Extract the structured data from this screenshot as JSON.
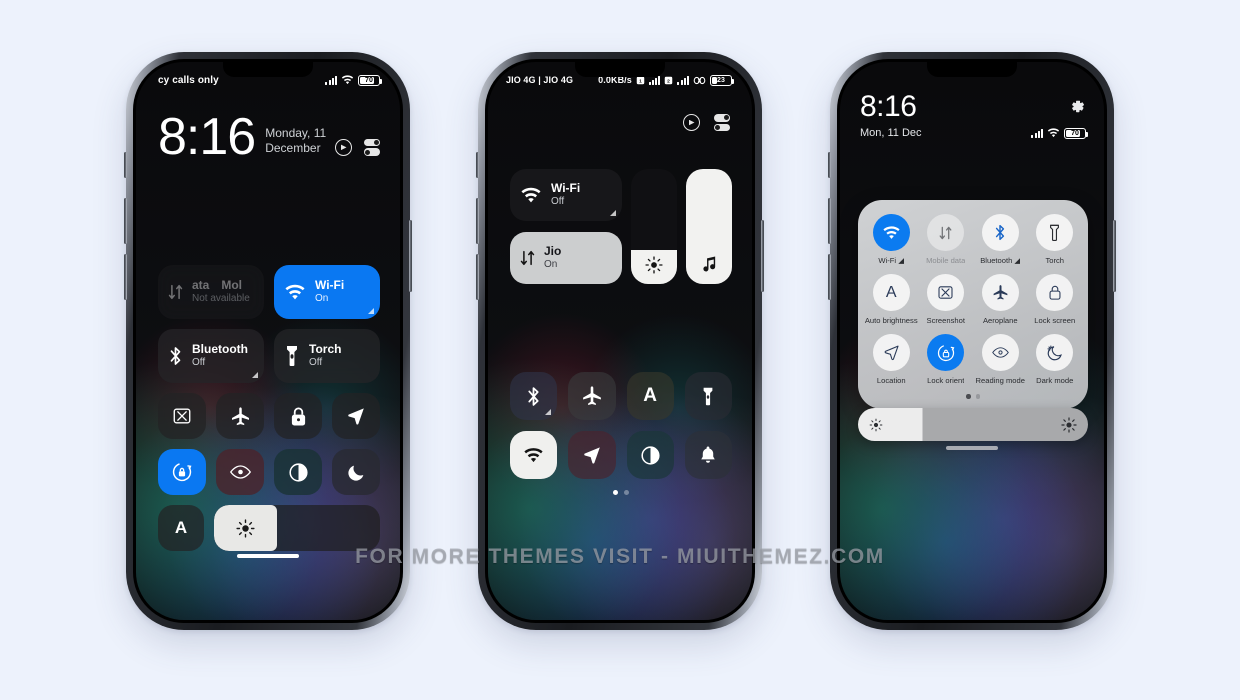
{
  "page": {
    "background_color": "#edf2fc",
    "watermark": "FOR MORE THEMES VISIT - MIUITHEMEZ.COM",
    "accent_blue": "#0a78f2"
  },
  "phone1": {
    "status_bar": {
      "carrier": "cy calls only",
      "battery": "70"
    },
    "lockscreen": {
      "time": "8:16",
      "date_line1": "Monday, 11",
      "date_line2": "December"
    },
    "top_icons": [
      {
        "name": "focus-mode-icon",
        "label": "Focus"
      },
      {
        "name": "quick-toggles-icon",
        "label": "Toggles"
      }
    ],
    "big_tiles": [
      {
        "name": "mobile-data",
        "title_a": "ata",
        "title_b": "Mol",
        "sub": "Not available",
        "state": "dim"
      },
      {
        "name": "wifi",
        "title": "Wi-Fi",
        "sub": "On",
        "state": "on"
      },
      {
        "name": "bluetooth",
        "title": "Bluetooth",
        "sub": "Off",
        "state": "off"
      },
      {
        "name": "torch",
        "title": "Torch",
        "sub": "Off",
        "state": "off"
      }
    ],
    "square_row_1": [
      {
        "name": "screenshot",
        "label": "Screenshot"
      },
      {
        "name": "aeroplane-mode",
        "label": "Aeroplane mode"
      },
      {
        "name": "lock-screen",
        "label": "Lock screen"
      },
      {
        "name": "location",
        "label": "Location"
      }
    ],
    "square_row_2": [
      {
        "name": "lock-orientation",
        "label": "Lock orientation",
        "state": "on"
      },
      {
        "name": "reading-mode",
        "label": "Reading mode",
        "state": "off"
      },
      {
        "name": "dark-mode",
        "label": "Dark mode",
        "state": "off"
      },
      {
        "name": "night-mode",
        "label": "Night mode",
        "state": "off"
      }
    ],
    "brightness": {
      "auto_label": "A",
      "fill_percent": 38
    }
  },
  "phone2": {
    "status_bar": {
      "carrier": "JIO 4G | JIO 4G",
      "speed": "0.0KB/s",
      "battery": "23"
    },
    "tiles": [
      {
        "name": "wifi",
        "title": "Wi-Fi",
        "sub": "Off",
        "state": "off"
      },
      {
        "name": "mobile-data",
        "title": "Jio",
        "sub": "On",
        "state": "on"
      }
    ],
    "sliders": [
      {
        "name": "brightness-slider",
        "fill_percent": 30
      },
      {
        "name": "volume-slider",
        "fill_percent": 100
      }
    ],
    "square_row_1": [
      {
        "name": "bluetooth",
        "label": "Bluetooth"
      },
      {
        "name": "aeroplane-mode",
        "label": "Aeroplane mode"
      },
      {
        "name": "auto-brightness",
        "label": "Auto brightness"
      },
      {
        "name": "torch",
        "label": "Torch"
      }
    ],
    "square_row_2": [
      {
        "name": "wifi-hotspot",
        "label": "Hotspot",
        "state": "on"
      },
      {
        "name": "location",
        "label": "Location",
        "state": "off"
      },
      {
        "name": "dark-mode",
        "label": "Dark mode",
        "state": "off"
      },
      {
        "name": "silent-mode",
        "label": "Silent",
        "state": "off"
      }
    ],
    "pager": {
      "pages": 2,
      "active": 0
    }
  },
  "phone3": {
    "header": {
      "time": "8:16",
      "date": "Mon, 11 Dec",
      "battery": "70"
    },
    "tiles_row_1": [
      {
        "name": "wifi",
        "label": "Wi-Fi ◢",
        "state": "on"
      },
      {
        "name": "mobile-data",
        "label": "Mobile data",
        "state": "dim"
      },
      {
        "name": "bluetooth",
        "label": "Bluetooth ◢",
        "state": "off"
      },
      {
        "name": "torch",
        "label": "Torch",
        "state": "off"
      }
    ],
    "tiles_row_2": [
      {
        "name": "auto-brightness",
        "label": "Auto brightness",
        "state": "off"
      },
      {
        "name": "screenshot",
        "label": "Screenshot",
        "state": "off"
      },
      {
        "name": "aeroplane-mode",
        "label": "Aeroplane ",
        "state": "off"
      },
      {
        "name": "lock-screen",
        "label": "Lock screen",
        "state": "off"
      }
    ],
    "tiles_row_3": [
      {
        "name": "location",
        "label": "Location",
        "state": "off"
      },
      {
        "name": "lock-orientation",
        "label": "Lock orient",
        "state": "on"
      },
      {
        "name": "reading-mode",
        "label": "Reading mode",
        "state": "off"
      },
      {
        "name": "dark-mode",
        "label": "Dark mode",
        "state": "off"
      }
    ],
    "pager": {
      "pages": 2,
      "active": 0
    },
    "brightness": {
      "fill_percent": 28
    }
  }
}
